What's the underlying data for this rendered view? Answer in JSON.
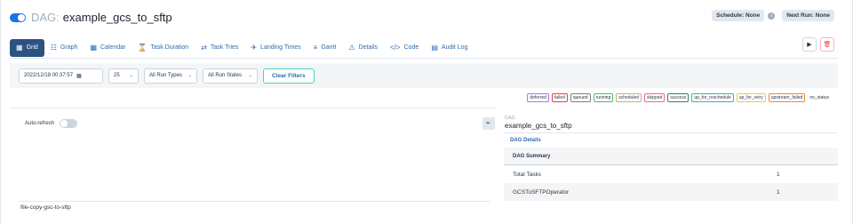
{
  "header": {
    "dag_prefix": "DAG:",
    "dag_id": "example_gcs_to_sftp",
    "schedule": "Schedule: None",
    "next_run": "Next Run: None",
    "info_icon": "i"
  },
  "nav": {
    "tabs": [
      {
        "label": "Grid",
        "icon": "grid-icon"
      },
      {
        "label": "Graph",
        "icon": "graph-icon"
      },
      {
        "label": "Calendar",
        "icon": "calendar-icon"
      },
      {
        "label": "Task Duration",
        "icon": "hourglass-icon"
      },
      {
        "label": "Task Tries",
        "icon": "refresh-icon"
      },
      {
        "label": "Landing Times",
        "icon": "landing-icon"
      },
      {
        "label": "Gantt",
        "icon": "gantt-icon"
      },
      {
        "label": "Details",
        "icon": "warning-icon"
      },
      {
        "label": "Code",
        "icon": "code-icon"
      },
      {
        "label": "Audit Log",
        "icon": "document-icon"
      }
    ],
    "active_tab": "Grid"
  },
  "filters": {
    "date": "2022/12/18 00:37:57",
    "count": "25",
    "run_types": "All Run Types",
    "run_states": "All Run States",
    "clear": "Clear Filters"
  },
  "legend": [
    {
      "label": "deferred",
      "color": "#9f7aea"
    },
    {
      "label": "failed",
      "color": "#e53e3e"
    },
    {
      "label": "queued",
      "color": "#808080"
    },
    {
      "label": "running",
      "color": "#48bb78"
    },
    {
      "label": "scheduled",
      "color": "#c0b283"
    },
    {
      "label": "skipped",
      "color": "#ed64a6"
    },
    {
      "label": "success",
      "color": "#2f855a"
    },
    {
      "label": "up_for_reschedule",
      "color": "#38b2ac"
    },
    {
      "label": "up_for_retry",
      "color": "#ecc94b"
    },
    {
      "label": "upstream_failed",
      "color": "#ed8936"
    },
    {
      "label": "no_status",
      "color": ""
    }
  ],
  "grid": {
    "auto_refresh": "Auto-refresh",
    "collapse": "⇤",
    "task": "file-copy-gsc-to-sftp"
  },
  "details": {
    "small": "DAG",
    "title": "example_gcs_to_sftp",
    "tab": "DAG Details",
    "summary_header": "DAG Summary",
    "rows": [
      {
        "label": "Total Tasks",
        "value": "1"
      },
      {
        "label": "GCSToSFTPOperator",
        "value": "1"
      }
    ]
  }
}
